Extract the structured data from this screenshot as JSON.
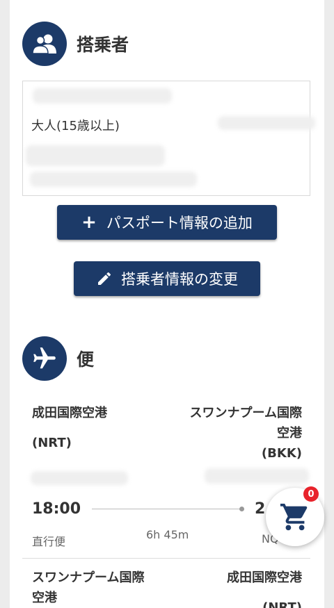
{
  "passengers": {
    "title": "搭乗者",
    "passenger_type": "大人(15歳以上)",
    "add_passport_label": "パスポート情報の追加",
    "add_passport_icon": "plus-icon",
    "edit_passenger_label": "搭乗者情報の変更",
    "edit_passenger_icon": "pencil-icon"
  },
  "flights": {
    "title": "便",
    "outbound": {
      "origin_name": "成田国際空港",
      "origin_code": "(NRT)",
      "destination_name_line1": "スワンナプーム国際",
      "destination_name_line2": "空港",
      "destination_code": "(BKK)",
      "depart_time": "18:00",
      "arrive_time_partial": "2",
      "stops": "直行便",
      "duration": "6h 45m",
      "flight_no_partial": "NQ"
    },
    "return": {
      "origin_name_line1": "スワンナプーム国際",
      "origin_name_line2": "空港",
      "destination_name": "成田国際空港",
      "destination_code_partial": "(NRT)"
    }
  },
  "cart": {
    "count": "0"
  },
  "colors": {
    "primary": "#1c3a68",
    "badge": "#e8232b"
  }
}
